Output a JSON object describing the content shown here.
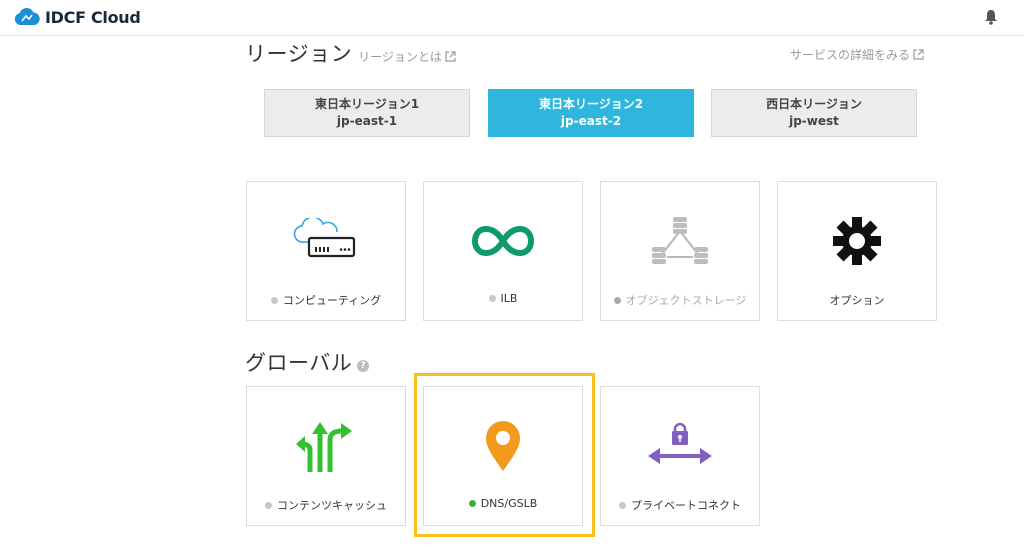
{
  "header": {
    "brand": "IDCF Cloud",
    "logo_icon": "cloud-icon",
    "bell_icon": "bell-icon"
  },
  "region_section": {
    "title": "リージョン",
    "about_link": "リージョンとは",
    "detail_link": "サービスの詳細をみる",
    "tabs": [
      {
        "name": "東日本リージョン1",
        "code": "jp-east-1",
        "active": false
      },
      {
        "name": "東日本リージョン2",
        "code": "jp-east-2",
        "active": true
      },
      {
        "name": "西日本リージョン",
        "code": "jp-west",
        "active": false
      }
    ]
  },
  "region_services": [
    {
      "label": "コンピューティング",
      "icon": "cloud-server-icon",
      "status": "gray"
    },
    {
      "label": "ILB",
      "icon": "infinity-icon",
      "status": "gray"
    },
    {
      "label": "オブジェクトストレージ",
      "icon": "object-storage-icon",
      "status": "gray"
    },
    {
      "label": "オプション",
      "icon": "gear-icon",
      "status": "none"
    }
  ],
  "global_section": {
    "title": "グローバル",
    "help_icon": "?"
  },
  "global_services": [
    {
      "label": "コンテンツキャッシュ",
      "icon": "cdn-arrows-icon",
      "status": "gray"
    },
    {
      "label": "DNS/GSLB",
      "icon": "map-pin-icon",
      "status": "green"
    },
    {
      "label": "プライベートコネクト",
      "icon": "private-connect-icon",
      "status": "gray"
    }
  ],
  "colors": {
    "accent": "#2fb6dc",
    "highlight": "#f7c221",
    "status_green": "#2fb53c",
    "ilb_green": "#0f9a6a",
    "dns_orange": "#f29a1b",
    "arrow_green": "#35c02f",
    "purple": "#7f5fbf"
  }
}
